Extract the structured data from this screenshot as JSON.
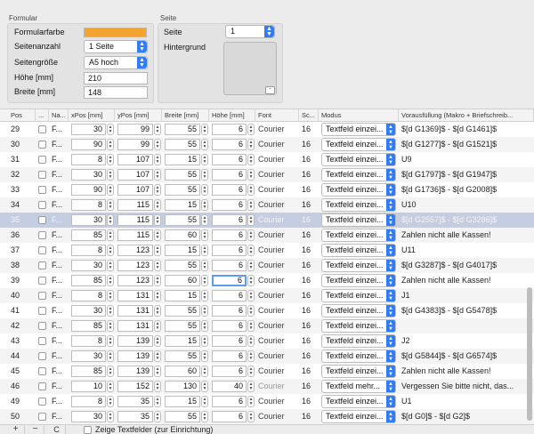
{
  "formular": {
    "title": "Formular",
    "farbe_label": "Formularfarbe",
    "seitenanzahl_label": "Seitenanzahl",
    "seitenanzahl_value": "1 Seite",
    "seitengroesse_label": "Seitengröße",
    "seitengroesse_value": "A5 hoch",
    "hoehe_label": "Höhe [mm]",
    "hoehe_value": "210",
    "breite_label": "Breite [mm]",
    "breite_value": "148",
    "color": "#f2a42f"
  },
  "seite": {
    "title": "Seite",
    "seite_label": "Seite",
    "seite_value": "1",
    "hintergrund_label": "Hintergrund",
    "remove_label": "-"
  },
  "table": {
    "headers": [
      "Pos",
      "...",
      "Na...",
      "xPos [mm]",
      "yPos [mm]",
      "Breite [mm]",
      "Höhe [mm]",
      "Font",
      "Sc...",
      "Modus",
      "Vorausfüllung (Makro + Briefschreib..."
    ],
    "rows": [
      {
        "pos": "29",
        "name": "F...",
        "x": "30",
        "y": "99",
        "w": "55",
        "h": "6",
        "font": "Courier",
        "size": "16",
        "mode": "Textfeld einzei...",
        "fill": "$[d G1369]$ - $[d G1461]$",
        "selected": false,
        "dim": false
      },
      {
        "pos": "30",
        "name": "F...",
        "x": "90",
        "y": "99",
        "w": "55",
        "h": "6",
        "font": "Courier",
        "size": "16",
        "mode": "Textfeld einzei...",
        "fill": "$[d G1277]$ - $[d G1521]$",
        "selected": false,
        "dim": false
      },
      {
        "pos": "31",
        "name": "F...",
        "x": "8",
        "y": "107",
        "w": "15",
        "h": "6",
        "font": "Courier",
        "size": "16",
        "mode": "Textfeld einzei...",
        "fill": "U9",
        "selected": false,
        "dim": false
      },
      {
        "pos": "32",
        "name": "F...",
        "x": "30",
        "y": "107",
        "w": "55",
        "h": "6",
        "font": "Courier",
        "size": "16",
        "mode": "Textfeld einzei...",
        "fill": "$[d G1797]$ - $[d G1947]$",
        "selected": false,
        "dim": false
      },
      {
        "pos": "33",
        "name": "F...",
        "x": "90",
        "y": "107",
        "w": "55",
        "h": "6",
        "font": "Courier",
        "size": "16",
        "mode": "Textfeld einzei...",
        "fill": "$[d G1736]$ - $[d G2008]$",
        "selected": false,
        "dim": false
      },
      {
        "pos": "34",
        "name": "F...",
        "x": "8",
        "y": "115",
        "w": "15",
        "h": "6",
        "font": "Courier",
        "size": "16",
        "mode": "Textfeld einzei...",
        "fill": "U10",
        "selected": false,
        "dim": false
      },
      {
        "pos": "35",
        "name": "F...",
        "x": "30",
        "y": "115",
        "w": "55",
        "h": "6",
        "font": "Courier",
        "size": "16",
        "mode": "Textfeld einzei...",
        "fill": "$[d G2557]$ - $[d G3286]$",
        "selected": true,
        "dim": false
      },
      {
        "pos": "36",
        "name": "F...",
        "x": "85",
        "y": "115",
        "w": "60",
        "h": "6",
        "font": "Courier",
        "size": "16",
        "mode": "Textfeld einzei...",
        "fill": "Zahlen nicht alle Kassen!",
        "selected": false,
        "dim": false
      },
      {
        "pos": "37",
        "name": "F...",
        "x": "8",
        "y": "123",
        "w": "15",
        "h": "6",
        "font": "Courier",
        "size": "16",
        "mode": "Textfeld einzei...",
        "fill": "U11",
        "selected": false,
        "dim": false
      },
      {
        "pos": "38",
        "name": "F...",
        "x": "30",
        "y": "123",
        "w": "55",
        "h": "6",
        "font": "Courier",
        "size": "16",
        "mode": "Textfeld einzei...",
        "fill": "$[d G3287]$ - $[d G4017]$",
        "selected": false,
        "dim": false
      },
      {
        "pos": "39",
        "name": "F...",
        "x": "85",
        "y": "123",
        "w": "60",
        "h": "6",
        "font": "Courier",
        "size": "16",
        "mode": "Textfeld einzei...",
        "fill": "Zahlen nicht alle Kassen!",
        "selected": false,
        "dim": false,
        "focus_h": true
      },
      {
        "pos": "40",
        "name": "F...",
        "x": "8",
        "y": "131",
        "w": "15",
        "h": "6",
        "font": "Courier",
        "size": "16",
        "mode": "Textfeld einzei...",
        "fill": "J1",
        "selected": false,
        "dim": false
      },
      {
        "pos": "41",
        "name": "F...",
        "x": "30",
        "y": "131",
        "w": "55",
        "h": "6",
        "font": "Courier",
        "size": "16",
        "mode": "Textfeld einzei...",
        "fill": "$[d G4383]$ - $[d G5478]$",
        "selected": false,
        "dim": false
      },
      {
        "pos": "42",
        "name": "F...",
        "x": "85",
        "y": "131",
        "w": "55",
        "h": "6",
        "font": "Courier",
        "size": "16",
        "mode": "Textfeld einzei...",
        "fill": "",
        "selected": false,
        "dim": false
      },
      {
        "pos": "43",
        "name": "F...",
        "x": "8",
        "y": "139",
        "w": "15",
        "h": "6",
        "font": "Courier",
        "size": "16",
        "mode": "Textfeld einzei...",
        "fill": "J2",
        "selected": false,
        "dim": false
      },
      {
        "pos": "44",
        "name": "F...",
        "x": "30",
        "y": "139",
        "w": "55",
        "h": "6",
        "font": "Courier",
        "size": "16",
        "mode": "Textfeld einzei...",
        "fill": "$[d G5844]$ - $[d G6574]$",
        "selected": false,
        "dim": false
      },
      {
        "pos": "45",
        "name": "F...",
        "x": "85",
        "y": "139",
        "w": "60",
        "h": "6",
        "font": "Courier",
        "size": "16",
        "mode": "Textfeld einzei...",
        "fill": "Zahlen nicht alle Kassen!",
        "selected": false,
        "dim": false
      },
      {
        "pos": "46",
        "name": "F...",
        "x": "10",
        "y": "152",
        "w": "130",
        "h": "40",
        "font": "Courier",
        "size": "16",
        "mode": "Textfeld mehr...",
        "fill": "Vergessen Sie bitte nicht, das...",
        "selected": false,
        "dim": true
      },
      {
        "pos": "49",
        "name": "F...",
        "x": "8",
        "y": "35",
        "w": "15",
        "h": "6",
        "font": "Courier",
        "size": "16",
        "mode": "Textfeld einzei...",
        "fill": "U1",
        "selected": false,
        "dim": false
      },
      {
        "pos": "50",
        "name": "F...",
        "x": "30",
        "y": "35",
        "w": "55",
        "h": "6",
        "font": "Courier",
        "size": "16",
        "mode": "Textfeld einzei...",
        "fill": "$[d G0]$ - $[d G2]$",
        "selected": false,
        "dim": false
      }
    ]
  },
  "bottom": {
    "add": "+",
    "remove": "−",
    "copy": "C",
    "show_fields_label": "Zeige Textfelder (zur Einrichtung)"
  }
}
